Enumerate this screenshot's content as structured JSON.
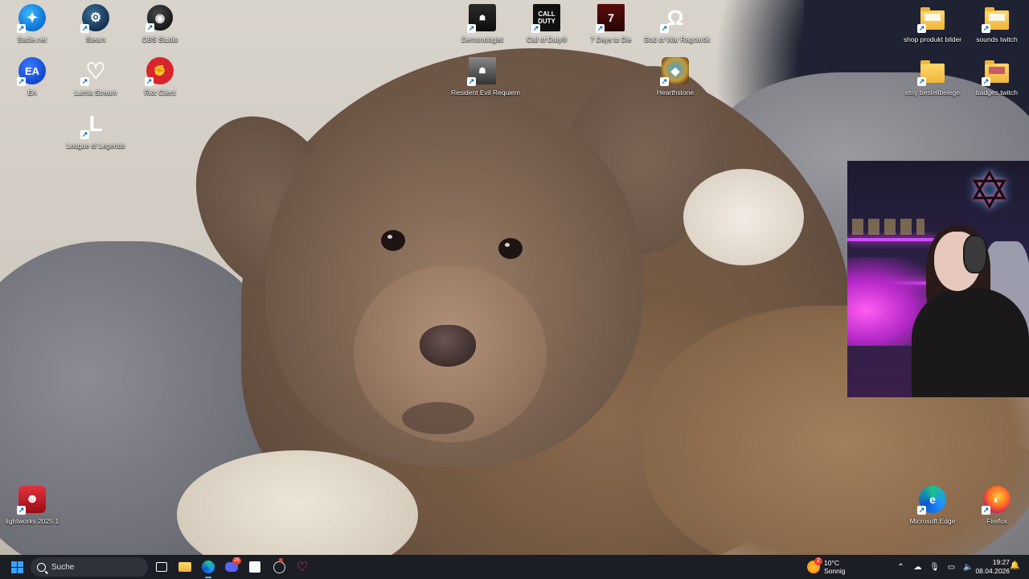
{
  "desktop": {
    "icons": {
      "battlenet": "Battle.net",
      "steam": "Steam",
      "obs": "OBS Studio",
      "ea": "EA",
      "lumia": "Lumia Stream",
      "riot": "Riot Client",
      "lol": "League of Legends",
      "demonologist": "Demonologist",
      "cod": "Call of Duty®",
      "sevendays": "7 Days to Die",
      "gow": "God of War Ragnarök",
      "revil": "Resident Evil Requiem",
      "hearthstone": "Hearthstone",
      "shop": "shop produkt bilder",
      "sounds": "sounds twitch",
      "etsy": "etsy bestellbelege",
      "badges": "badges twitch",
      "lightworks": "lightworks 2025.1",
      "edge": "Microsoft Edge",
      "firefox": "Firefox"
    },
    "icon_glyphs": {
      "battlenet": "✦",
      "steam": "⚙",
      "obs": "◉",
      "ea": "EA",
      "lumia": "♡",
      "riot": "✊",
      "lol": "L",
      "demonologist": "☗",
      "cod": "CALL\nDUTY",
      "sevendays": "7",
      "gow": "Ω",
      "revil": "☗",
      "hearthstone": "◆",
      "lightworks": "☻",
      "edge": "e",
      "firefox": "◐"
    }
  },
  "taskbar": {
    "search_placeholder": "Suche",
    "weather": {
      "temp": "10°C",
      "condition": "Sonnig",
      "badge": "2"
    },
    "clock": {
      "time": "19:27",
      "date": "08.04.2026"
    },
    "discord_badge": "25"
  },
  "colors": {
    "taskbar_bg": "#1c1e25",
    "accent": "#4cc2ff",
    "folder": "#f0b53a"
  }
}
